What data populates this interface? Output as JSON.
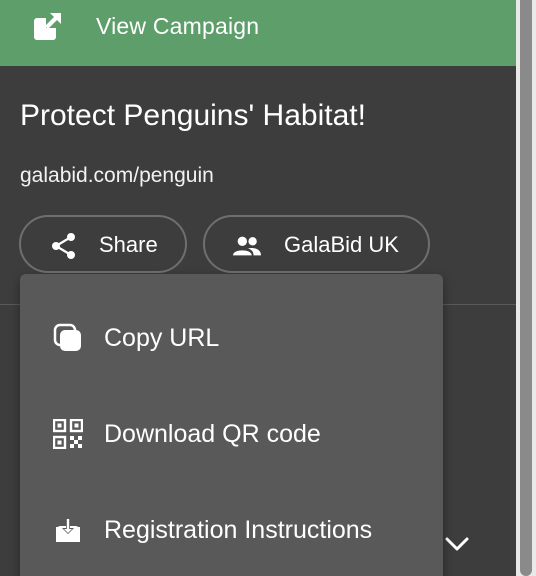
{
  "header": {
    "view_label": "View Campaign",
    "icon": "open-in-new-icon",
    "background": "#5e9e6b"
  },
  "campaign": {
    "title": "Protect Penguins' Habitat!",
    "url": "galabid.com/penguin"
  },
  "actions": {
    "share_label": "Share",
    "share_icon": "share-icon",
    "org_label": "GalaBid UK",
    "org_icon": "people-icon"
  },
  "share_menu": {
    "items": [
      {
        "label": "Copy URL",
        "icon": "copy-icon"
      },
      {
        "label": "Download QR code",
        "icon": "qr-code-icon"
      },
      {
        "label": "Registration Instructions",
        "icon": "download-icon"
      }
    ],
    "background": "#595959"
  },
  "theme": {
    "page_background": "#3d3d3d",
    "text": "#ffffff"
  }
}
